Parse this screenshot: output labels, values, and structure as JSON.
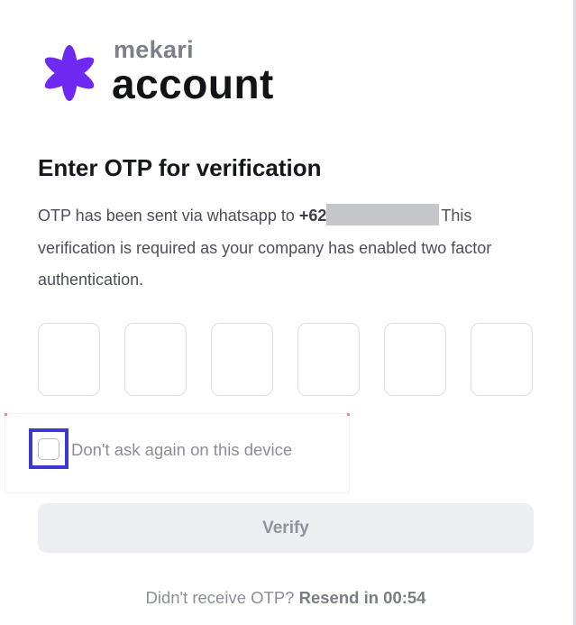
{
  "logo": {
    "brand": "mekari",
    "product": "account",
    "star_color": "#6e29f2"
  },
  "title": "Enter OTP for verification",
  "description": {
    "before_phone": "OTP has been sent via whatsapp to ",
    "phone_prefix": "+62",
    "after_phone": "This verification is required as your company has enabled two factor authentication."
  },
  "otp": {
    "digits": [
      "",
      "",
      "",
      "",
      "",
      ""
    ]
  },
  "remember_device": {
    "label": "Don't ask again on this device",
    "checked": false,
    "highlight_color": "#3d38cf"
  },
  "verify": {
    "label": "Verify",
    "enabled": false
  },
  "resend": {
    "prompt": "Didn't receive OTP? ",
    "timer_text": "Resend in 00:54"
  }
}
